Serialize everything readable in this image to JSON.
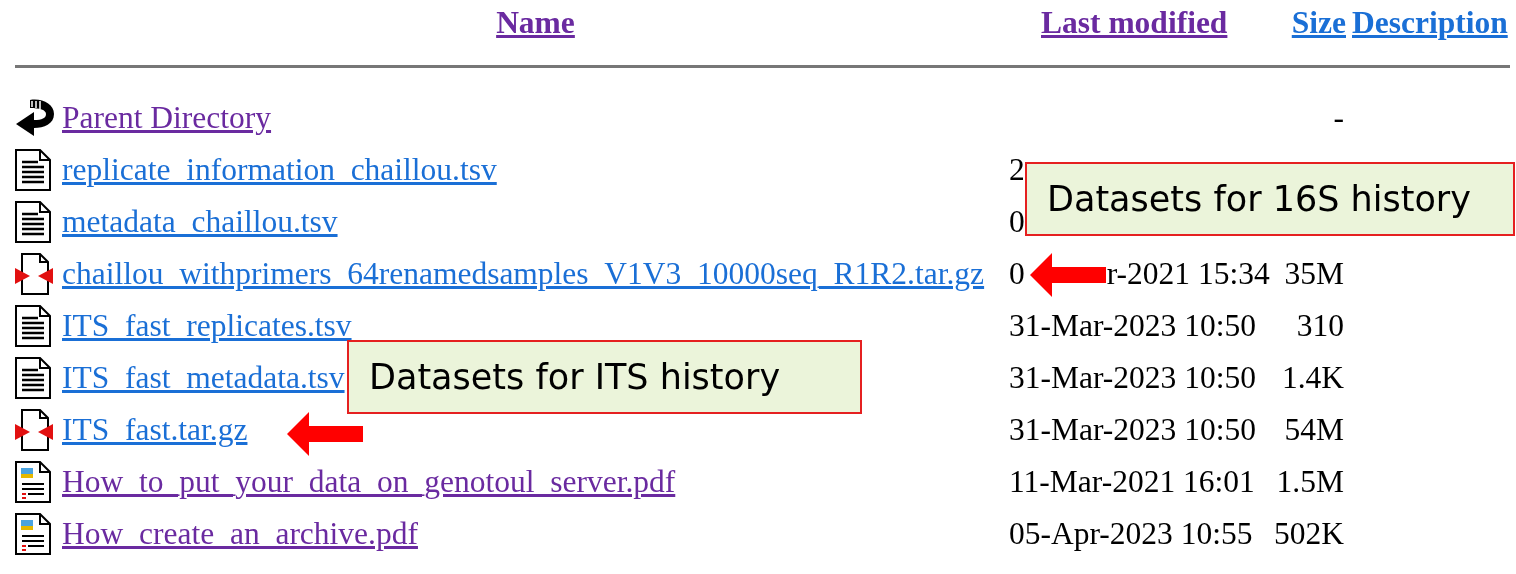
{
  "columns": [
    {
      "label": "Name",
      "visited": true
    },
    {
      "label": "Last modified",
      "visited": true
    },
    {
      "label": "Size",
      "visited": false
    },
    {
      "label": "Description",
      "visited": false
    }
  ],
  "rows": [
    {
      "kind": "parent",
      "name": "Parent Directory",
      "visited": true,
      "size": "-"
    },
    {
      "kind": "text",
      "name": "replicate_information_chaillou.tsv",
      "visited": false,
      "modified": "2"
    },
    {
      "kind": "text",
      "name": "metadata_chaillou.tsv",
      "visited": false,
      "modified": "0"
    },
    {
      "kind": "archive",
      "name": "chaillou_withprimers_64renamedsamples_V1V3_10000seq_R1R2.tar.gz",
      "visited": false,
      "modified": "0",
      "modified_rest": "r-2021 15:34",
      "size": "35M"
    },
    {
      "kind": "text",
      "name": "ITS_fast_replicates.tsv",
      "visited": false,
      "modified": "31-Mar-2023 10:50",
      "size": "310"
    },
    {
      "kind": "text",
      "name": "ITS_fast_metadata.tsv",
      "visited": false,
      "modified": "31-Mar-2023 10:50",
      "size": "1.4K"
    },
    {
      "kind": "archive",
      "name": "ITS_fast.tar.gz",
      "visited": false,
      "modified": "31-Mar-2023 10:50",
      "size": "54M"
    },
    {
      "kind": "pdf",
      "name": "How_to_put_your_data_on_genotoul_server.pdf",
      "visited": true,
      "modified": "11-Mar-2021 16:01",
      "size": "1.5M"
    },
    {
      "kind": "pdf",
      "name": "How_create_an_archive.pdf",
      "visited": true,
      "modified": "05-Apr-2023 10:55",
      "size": "502K"
    }
  ],
  "callouts": [
    {
      "text": "Datasets for 16S history"
    },
    {
      "text": "Datasets for ITS history"
    }
  ]
}
